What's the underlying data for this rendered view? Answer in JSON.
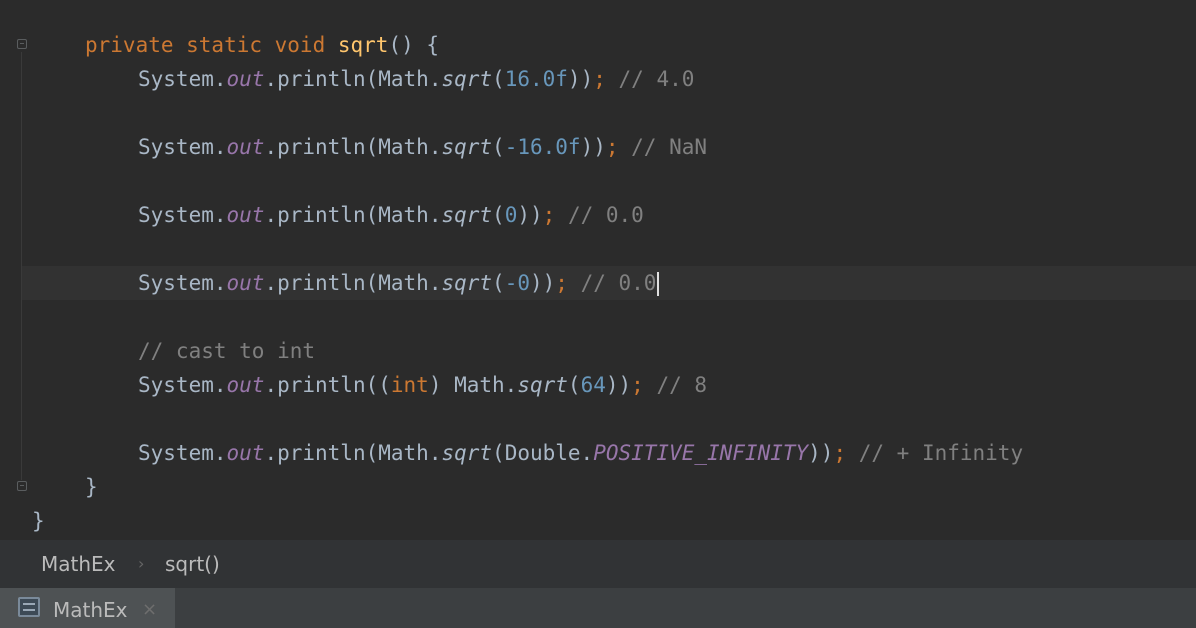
{
  "editor": {
    "method_signature": {
      "modifiers": "private static void ",
      "name": "sqrt",
      "params": "() {"
    },
    "lines": [
      {
        "prefix": "System.",
        "field": "out",
        "mid": ".println(Math.",
        "call": "sqrt",
        "open": "(",
        "arg": "16.0f",
        "close": "))",
        "semi": ";",
        "comment": " // 4.0"
      },
      {
        "prefix": "System.",
        "field": "out",
        "mid": ".println(Math.",
        "call": "sqrt",
        "open": "(",
        "arg": "-16.0f",
        "close": "))",
        "semi": ";",
        "comment": " // NaN"
      },
      {
        "prefix": "System.",
        "field": "out",
        "mid": ".println(Math.",
        "call": "sqrt",
        "open": "(",
        "arg": "0",
        "close": "))",
        "semi": ";",
        "comment": " // 0.0"
      },
      {
        "prefix": "System.",
        "field": "out",
        "mid": ".println(Math.",
        "call": "sqrt",
        "open": "(",
        "arg": "-0",
        "close": "))",
        "semi": ";",
        "comment": " // 0.0"
      }
    ],
    "cast_comment": "// cast to int",
    "cast_line": {
      "prefix": "System.",
      "field": "out",
      "mid": ".println((",
      "kw": "int",
      "mid2": ") Math.",
      "call": "sqrt",
      "open": "(",
      "arg": "64",
      "close": "))",
      "semi": ";",
      "comment": " // 8"
    },
    "infinity_line": {
      "prefix": "System.",
      "field": "out",
      "mid": ".println(Math.",
      "call": "sqrt",
      "open": "(Double.",
      "const": "POSITIVE_INFINITY",
      "close": "))",
      "semi": ";",
      "comment": " // + Infinity"
    },
    "method_close": "}",
    "class_close": "}"
  },
  "breadcrumb": {
    "class_name": "MathEx",
    "separator": "›",
    "method_name": "sqrt()"
  },
  "tabs": [
    {
      "label": "MathEx",
      "icon": "class-file-icon",
      "close": "×"
    }
  ]
}
